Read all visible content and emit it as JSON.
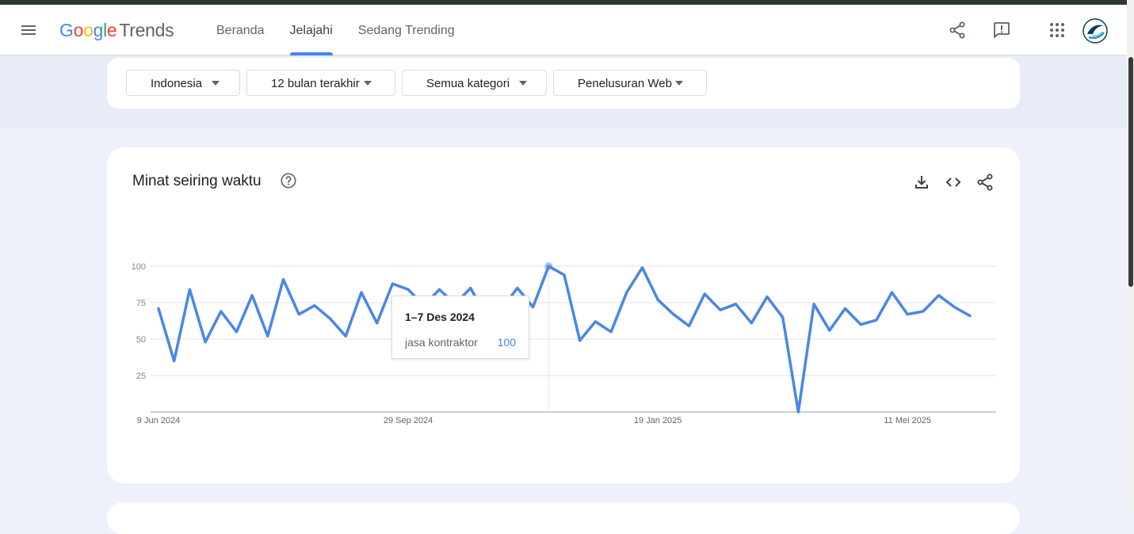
{
  "header": {
    "logo_google": [
      "G",
      "o",
      "o",
      "g",
      "l",
      "e"
    ],
    "logo_trends": "Trends",
    "tabs": [
      {
        "label": "Beranda",
        "active": false
      },
      {
        "label": "Jelajahi",
        "active": true
      },
      {
        "label": "Sedang Trending",
        "active": false
      }
    ],
    "icons": [
      "menu-icon",
      "share-icon",
      "feedback-icon",
      "apps-icon",
      "avatar"
    ]
  },
  "filters": [
    {
      "label": "Indonesia"
    },
    {
      "label": "12 bulan terakhir"
    },
    {
      "label": "Semua kategori"
    },
    {
      "label": "Penelusuran Web"
    }
  ],
  "interest_card": {
    "title": "Minat seiring waktu",
    "icons": [
      "help-icon",
      "download-icon",
      "embed-icon",
      "share-icon"
    ]
  },
  "tooltip": {
    "date": "1–7 Des 2024",
    "term": "jasa kontraktor",
    "value": "100"
  },
  "colors": {
    "accent": "#4285f4",
    "line": "#4a86e8",
    "background": "#eef1f9"
  },
  "chart_data": {
    "type": "line",
    "title": "Minat seiring waktu",
    "x_tick_labels": [
      "9 Jun 2024",
      "29 Sep 2024",
      "19 Jan 2025",
      "11 Mei 2025"
    ],
    "y_ticks": [
      25,
      50,
      75,
      100
    ],
    "ylim": [
      0,
      100
    ],
    "grid": true,
    "series": [
      {
        "name": "jasa kontraktor",
        "values": [
          71,
          35,
          84,
          48,
          69,
          55,
          80,
          52,
          91,
          67,
          73,
          64,
          52,
          82,
          61,
          88,
          84,
          73,
          84,
          74,
          85,
          66,
          71,
          85,
          72,
          100,
          94,
          49,
          62,
          55,
          82,
          99,
          77,
          67,
          59,
          81,
          70,
          74,
          61,
          79,
          65,
          0,
          74,
          56,
          71,
          60,
          63,
          82,
          67,
          69,
          80,
          72,
          66
        ]
      }
    ],
    "highlight_index": 25
  }
}
